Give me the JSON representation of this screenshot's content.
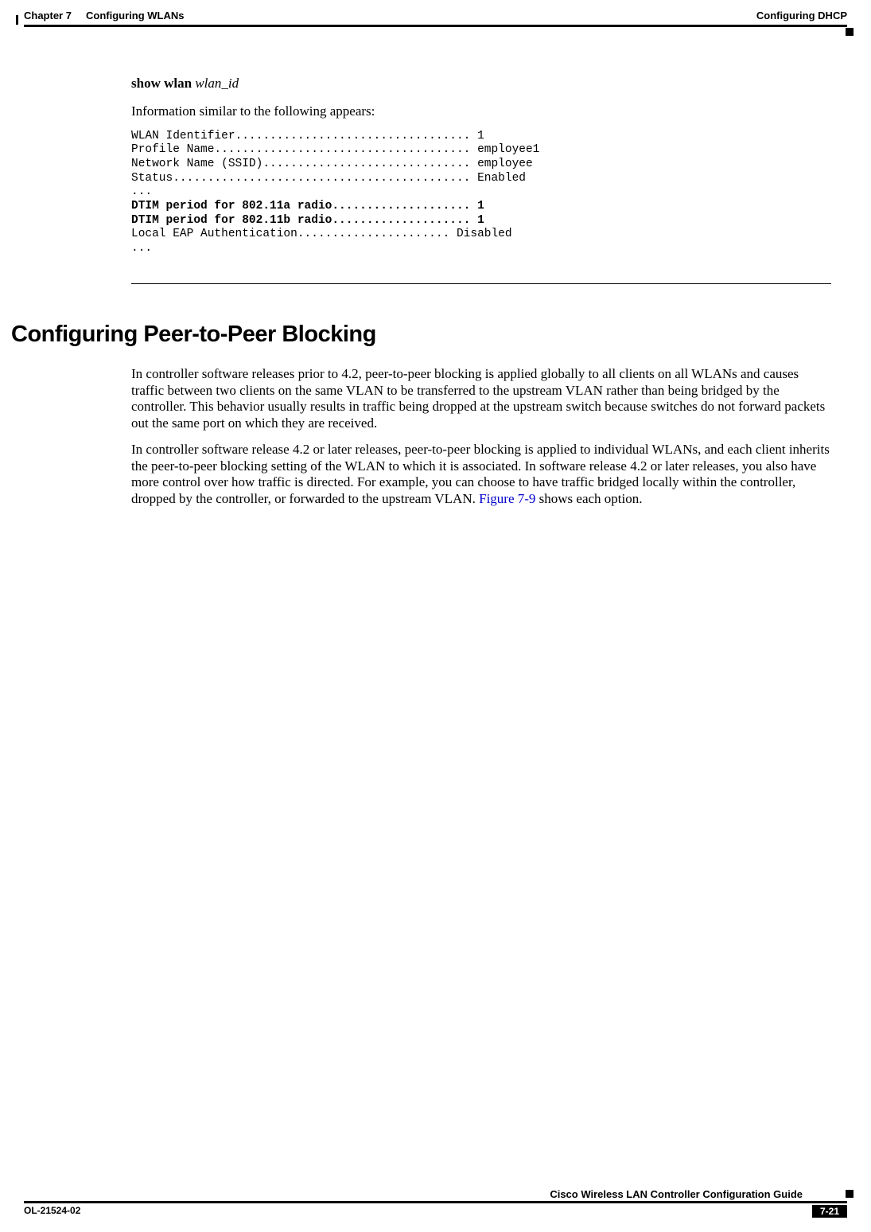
{
  "header": {
    "chapter": "Chapter 7",
    "chapter_title": "Configuring WLANs",
    "section": "Configuring DHCP"
  },
  "command": {
    "bold": "show wlan",
    "italic": "wlan_id"
  },
  "intro": "Information similar to the following appears:",
  "output": {
    "l1": "WLAN Identifier.................................. 1",
    "l2": "Profile Name..................................... employee1",
    "l3": "Network Name (SSID).............................. employee",
    "l4": "Status........................................... Enabled",
    "l5": "...",
    "l6": "DTIM period for 802.11a radio.................... 1",
    "l7": "DTIM period for 802.11b radio.................... 1",
    "l8": "Local EAP Authentication...................... Disabled",
    "l9": "..."
  },
  "section_heading": "Configuring Peer-to-Peer Blocking",
  "para1": "In controller software releases prior to 4.2, peer-to-peer blocking is applied globally to all clients on all WLANs and causes traffic between two clients on the same VLAN to be transferred to the upstream VLAN rather than being bridged by the controller. This behavior usually results in traffic being dropped at the upstream switch because switches do not forward packets out the same port on which they are received.",
  "para2_a": "In controller software release 4.2 or later releases, peer-to-peer blocking is applied to individual WLANs, and each client inherits the peer-to-peer blocking setting of the WLAN to which it is associated. In software release 4.2 or later releases, you also have more control over how traffic is directed. For example, you can choose to have traffic bridged locally within the controller, dropped by the controller, or forwarded to the upstream VLAN. ",
  "para2_link": "Figure 7-9",
  "para2_b": " shows each option.",
  "footer": {
    "guide": "Cisco Wireless LAN Controller Configuration Guide",
    "doc_id": "OL-21524-02",
    "page": "7-21"
  }
}
